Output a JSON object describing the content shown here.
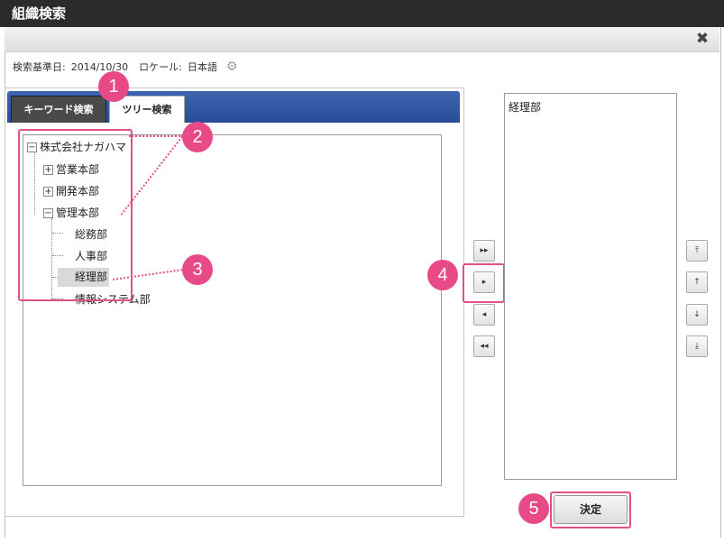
{
  "window": {
    "title": "組織検索",
    "close_icon": "✖"
  },
  "info": {
    "base_date_label": "検索基準日:",
    "base_date": "2014/10/30",
    "locale_label": "ロケール:",
    "locale": "日本語"
  },
  "tabs": [
    {
      "label": "キーワード検索"
    },
    {
      "label": "ツリー検索"
    }
  ],
  "tree": {
    "root": "株式会社ナガハマ",
    "children": [
      {
        "label": "営業本部",
        "expander": "+"
      },
      {
        "label": "開発本部",
        "expander": "+"
      },
      {
        "label": "管理本部",
        "expander": "−",
        "children": [
          {
            "label": "総務部"
          },
          {
            "label": "人事部"
          },
          {
            "label": "経理部"
          },
          {
            "label": "情報システム部"
          }
        ]
      }
    ],
    "root_expander": "−"
  },
  "move_buttons": {
    "add_all": "▸▸",
    "add": "▸",
    "remove": "◂",
    "remove_all": "◂◂"
  },
  "order_buttons": {
    "top": "⤒",
    "up": "↑",
    "down": "↓",
    "bottom": "⤓"
  },
  "selected": [
    "経理部"
  ],
  "confirm_label": "決定",
  "badges": [
    "1",
    "2",
    "3",
    "4",
    "5"
  ],
  "colors": {
    "accent": "#e84a87",
    "tab_blue": "#2f55a4",
    "titlebar": "#2b2b2b"
  }
}
